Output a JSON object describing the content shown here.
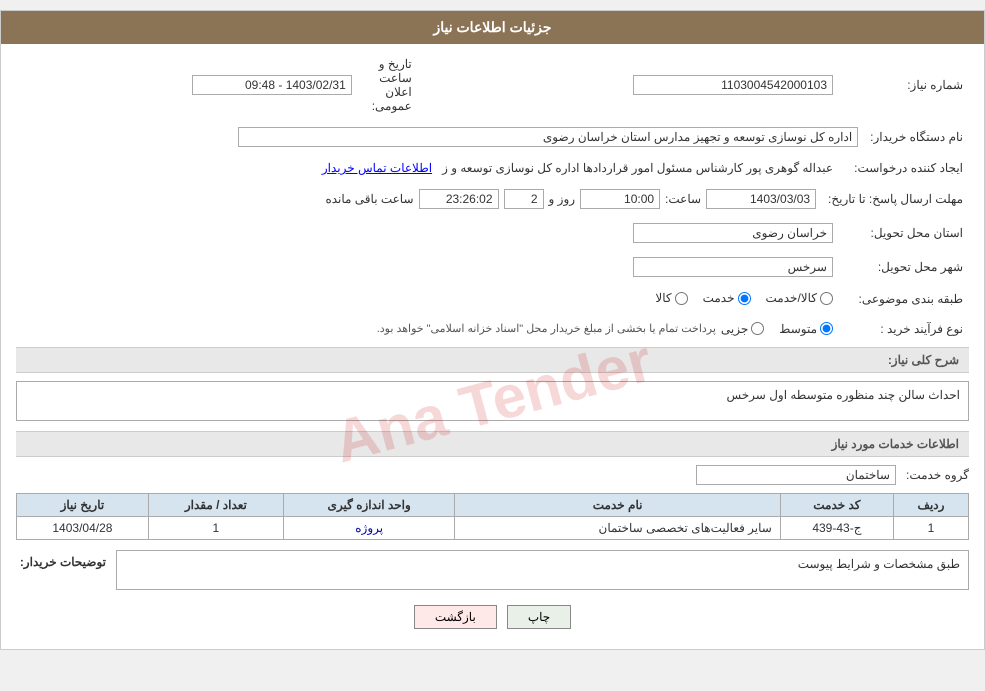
{
  "header": {
    "title": "جزئیات اطلاعات نیاز"
  },
  "fields": {
    "shomara_label": "شماره نیاز:",
    "shomara_value": "1103004542000103",
    "tarikh_label": "تاریخ و ساعت اعلان عمومی:",
    "tarikh_value": "1403/02/31 - 09:48",
    "nam_dastgah_label": "نام دستگاه خریدار:",
    "nam_dastgah_value": "اداره کل نوسازی  توسعه و تجهیز مدارس استان خراسان رضوی",
    "ijad_label": "ایجاد کننده درخواست:",
    "ijad_value": "عبداله گوهری پور کارشناس مسئول امور قراردادها  اداره کل نوسازی  توسعه و ز",
    "ijad_link": "اطلاعات تماس خریدار",
    "mohlat_label": "مهلت ارسال پاسخ: تا تاریخ:",
    "mohlat_date": "1403/03/03",
    "mohlat_saaat_label": "ساعت:",
    "mohlat_saat_value": "10:00",
    "mohlat_rooz_label": "روز و",
    "mohlat_rooz_value": "2",
    "mohlat_baqi_label": "ساعت باقی مانده",
    "mohlat_baqi_value": "23:26:02",
    "ostan_label": "استان محل تحویل:",
    "ostan_value": "خراسان رضوی",
    "shahr_label": "شهر محل تحویل:",
    "shahr_value": "سرخس",
    "tabaqe_label": "طبقه بندی موضوعی:",
    "tabaqe_options": [
      {
        "label": "کالا",
        "selected": false
      },
      {
        "label": "خدمت",
        "selected": true
      },
      {
        "label": "کالا/خدمت",
        "selected": false
      }
    ],
    "nooe_farayand_label": "نوع فرآیند خرید :",
    "nooe_farayand_options": [
      {
        "label": "جزیی",
        "selected": false
      },
      {
        "label": "متوسط",
        "selected": true
      }
    ],
    "nooe_farayand_note": "پرداخت تمام یا بخشی از مبلغ خریدار محل \"اسناد خزانه اسلامی\" خواهد بود.",
    "sharh_label": "شرح کلی نیاز:",
    "sharh_value": "احداث سالن چند منظوره متوسطه اول سرخس",
    "khademat_label": "اطلاعات خدمات مورد نیاز",
    "goroh_label": "گروه خدمت:",
    "goroh_value": "ساختمان",
    "table": {
      "headers": [
        "ردیف",
        "کد خدمت",
        "نام خدمت",
        "واحد اندازه گیری",
        "تعداد / مقدار",
        "تاریخ نیاز"
      ],
      "rows": [
        {
          "radif": "1",
          "kod": "ج-43-439",
          "nam": "سایر فعالیت‌های تخصصی ساختمان",
          "vahed": "پروژه",
          "tedad": "1",
          "tarikh": "1403/04/28"
        }
      ]
    },
    "tvsif_label": "توضیحات خریدار:",
    "tvsif_value": "طبق مشخصات و شرایط پیوست"
  },
  "buttons": {
    "print_label": "چاپ",
    "back_label": "بازگشت"
  }
}
